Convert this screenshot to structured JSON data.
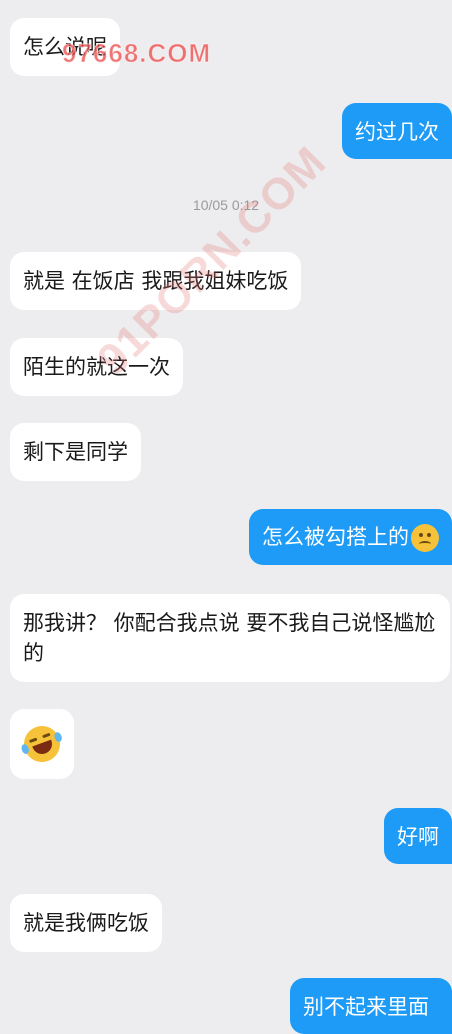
{
  "messages": [
    {
      "id": 1,
      "side": "received",
      "text": "怎么说呢"
    },
    {
      "id": 2,
      "side": "sent",
      "text": "约过几次"
    },
    {
      "id": 3,
      "side": "received",
      "text": "就是 在饭店 我跟我姐妹吃饭"
    },
    {
      "id": 4,
      "side": "received",
      "text": "陌生的就这一次"
    },
    {
      "id": 5,
      "side": "received",
      "text": "剩下是同学"
    },
    {
      "id": 6,
      "side": "sent",
      "text": "怎么被勾搭上的",
      "emoji": "worried-face-icon"
    },
    {
      "id": 7,
      "side": "received",
      "text": "那我讲？ 你配合我点说 要不我自己说怪尴尬的"
    },
    {
      "id": 8,
      "side": "received",
      "emoji": "laughing-tears-icon"
    },
    {
      "id": 9,
      "side": "sent",
      "text": "好啊"
    },
    {
      "id": 10,
      "side": "received",
      "text": "就是我俩吃饭"
    },
    {
      "id": 11,
      "side": "sent",
      "text": "别不起来里面"
    }
  ],
  "timestamp": "10/05 0:12",
  "watermarks": {
    "top": "97668.COM",
    "diagonal": "91PORN.COM"
  },
  "colors": {
    "background": "#ededef",
    "sent_bubble": "#1d9bf6",
    "received_bubble": "#ffffff"
  }
}
